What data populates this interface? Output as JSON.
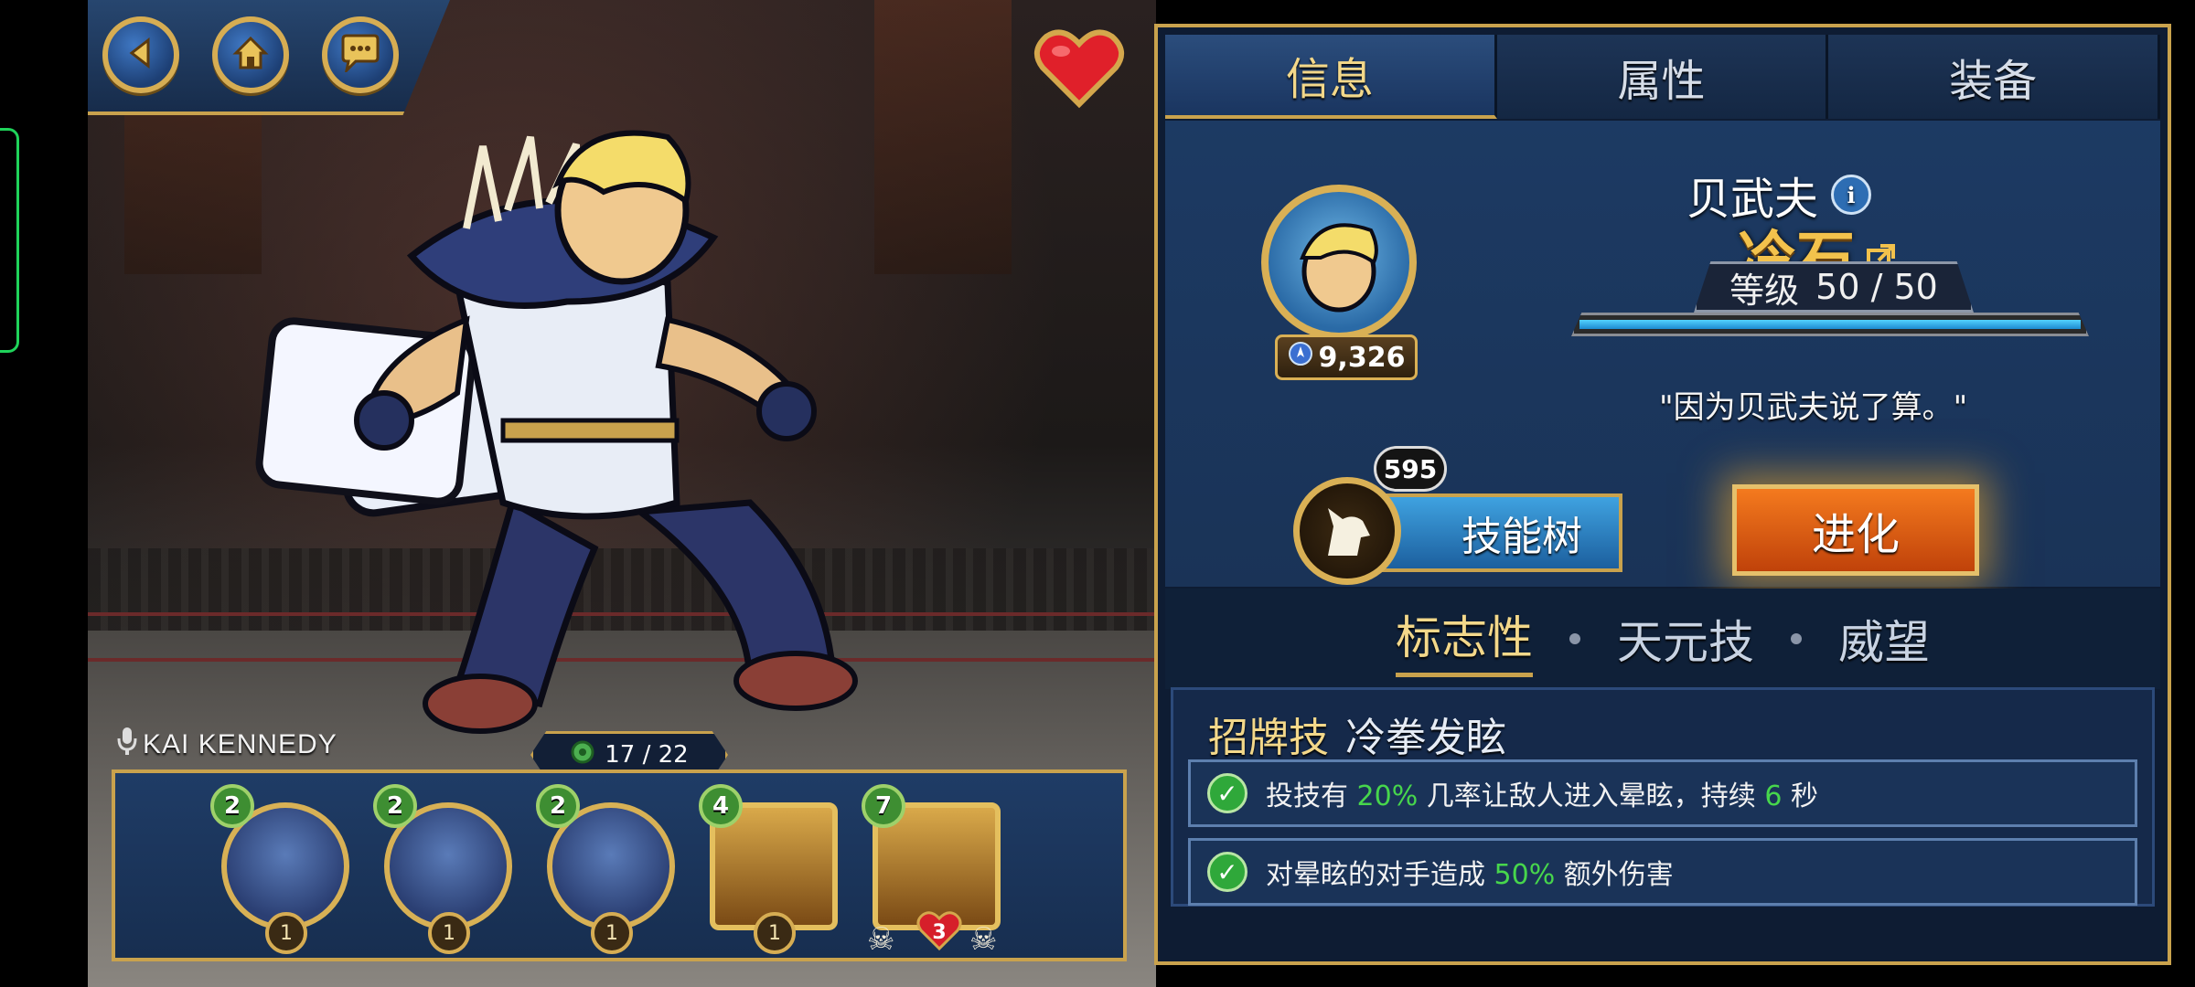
{
  "colors": {
    "gold": "#c9a24d",
    "panel": "#0e1c33",
    "accent_green": "#47d64c",
    "evolve": "#e0631a",
    "skill": "#2f86c9"
  },
  "nav": {
    "back_icon": "back-arrow-icon",
    "home_icon": "home-icon",
    "chat_icon": "chat-icon"
  },
  "favorite_icon": "heart-icon",
  "announcer": {
    "icon": "microphone-icon",
    "name": "KAI KENNEDY"
  },
  "team": {
    "count_label": "17 / 22",
    "fighters": [
      {
        "level": "2",
        "stars": "1",
        "style": "circle"
      },
      {
        "level": "2",
        "stars": "1",
        "style": "circle"
      },
      {
        "level": "2",
        "stars": "1",
        "style": "circle"
      },
      {
        "level": "4",
        "stars": "1",
        "style": "film"
      },
      {
        "level": "7",
        "hearts": "3",
        "style": "film"
      }
    ]
  },
  "tabs": [
    {
      "label": "信息",
      "active": true
    },
    {
      "label": "属性",
      "active": false
    },
    {
      "label": "装备",
      "active": false
    }
  ],
  "hero": {
    "name": "贝武夫",
    "variant": "冷石",
    "level_label": "等级",
    "level_value": "50 / 50",
    "level_progress": 1.0,
    "power": "9,326",
    "quote": "\"因为贝武夫说了算。\""
  },
  "actions": {
    "skill_tree_label": "技能树",
    "skill_points": "595",
    "evolve_label": "进化"
  },
  "subtabs": [
    {
      "label": "标志性",
      "active": true
    },
    {
      "label": "天元技",
      "active": false
    },
    {
      "label": "威望",
      "active": false
    }
  ],
  "ability": {
    "type": "招牌技",
    "name": "冷拳发眩",
    "effects": [
      {
        "pre": "投技有",
        "v1": "20%",
        "mid": "几率让敌人进入晕眩，持续",
        "v2": "6",
        "post": "秒"
      },
      {
        "pre": "对晕眩的对手造成",
        "v1": "50%",
        "mid": "额外伤害",
        "v2": "",
        "post": ""
      }
    ]
  }
}
